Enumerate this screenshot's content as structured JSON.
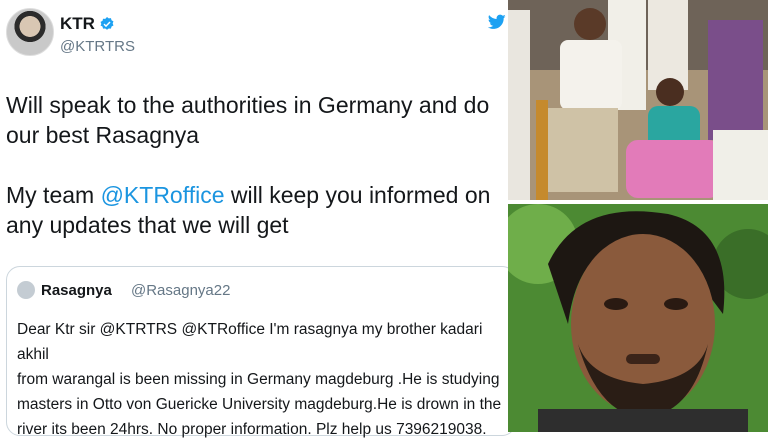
{
  "tweet": {
    "author_name": "KTR",
    "author_handle": "@KTRTRS",
    "verified": true,
    "paragraph1": "Will speak to the authorities in Germany and do our best Rasagnya",
    "p2_before": "My team ",
    "p2_mention": "@KTRoffice",
    "p2_after": " will keep you informed on any updates that we will get"
  },
  "quoted": {
    "author_name": "Rasagnya",
    "author_handle": "@Rasagnya22",
    "text": "Dear Ktr sir @KTRTRS @KTRoffice I'm rasagnya my brother kadari akhil\nfrom warangal is been missing in Germany magdeburg .He is studying\nmasters in Otto von Guericke University  magdeburg.He is drown in the\nriver its been 24hrs. No proper information. Plz help us 7396219038."
  },
  "colors": {
    "link": "#1b95e0",
    "verified": "#1da1f2",
    "twitter": "#1da1f2"
  },
  "icons": {
    "verified": "verified-badge-icon",
    "bird": "twitter-bird-icon"
  }
}
